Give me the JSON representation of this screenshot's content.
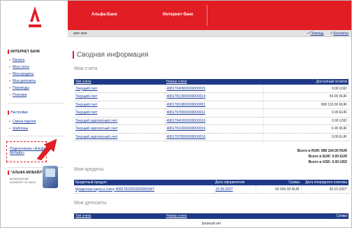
{
  "header": {
    "link1": "Альфа-Банк",
    "link2": "Интернет-банк"
  },
  "subbar": {
    "user": "qwe qwe",
    "help": "Помощь",
    "contacts": "Контакты"
  },
  "sidebar": {
    "section1": "ИНТЕРНЕТ БАНК",
    "items": [
      "Начало",
      "Мои счета",
      "Мои кредиты",
      "Мои депозиты",
      "Переводы",
      "Платежи"
    ],
    "section2": "Настройки",
    "settings": [
      "Смена пароля",
      "Шаблоны"
    ],
    "mobile_link": "Подключение «Альфа-Мобайл»",
    "promo_title": "\"АЛЬФА-МОБАЙЛ\"",
    "promo_text": "МОБИЛЬНЫЙ КОМФОРТ 24 ЧАСА"
  },
  "main": {
    "title": "Сводная информация",
    "accounts_title": "Мои счета",
    "accounts_headers": [
      "Тип счета",
      "Номер счета",
      "Доступный остаток"
    ],
    "accounts": [
      {
        "type": "Текущий счет",
        "number": "40817040900000000015",
        "balance": "0.00 USD"
      },
      {
        "type": "Текущий счет",
        "number": "40817810900000000014",
        "balance": "54.00 RUR"
      },
      {
        "type": "Текущий счет",
        "number": "40817810800000000001",
        "balance": "998 110.00 RUR"
      },
      {
        "type": "Текущий счет",
        "number": "40817978300000000011",
        "balance": "0.00 EUR"
      },
      {
        "type": "Текущий зарплатный счет",
        "number": "40817940200000000016",
        "balance": "0.00 USD"
      },
      {
        "type": "Текущий зарплатный счет",
        "number": "40817810200000000016",
        "balance": "0.00 RUR"
      },
      {
        "type": "Текущий зарплатный счет",
        "number": "40817978000000000016",
        "balance": "0.00 EUR"
      }
    ],
    "totals": [
      "Всего в RUR: 998 164.00 RUR",
      "Всего в EUR: 0.00 EUR",
      "Всего в USD: 0.00 USD"
    ],
    "credits_title": "Мои кредиты",
    "credits_headers": [
      "Кредитный продукт",
      "Дата оформления",
      "Сумма",
      "Дата очередного платежа"
    ],
    "credits": [
      {
        "product": "Кредитная карта к счету 40817810500000000047",
        "date": "15.08.2007",
        "sum": "60 000.00 RUR",
        "next": "30.10.2007"
      }
    ],
    "deposits_title": "Мои депозиты",
    "deposits_headers": [
      "Тип счета",
      "Номер счета",
      "Сумма"
    ],
    "deposits_empty": "Записей нет"
  },
  "colors": {
    "brand_red": "#e31d24",
    "table_header": "#1e3a86",
    "link": "#1a3c9c"
  }
}
